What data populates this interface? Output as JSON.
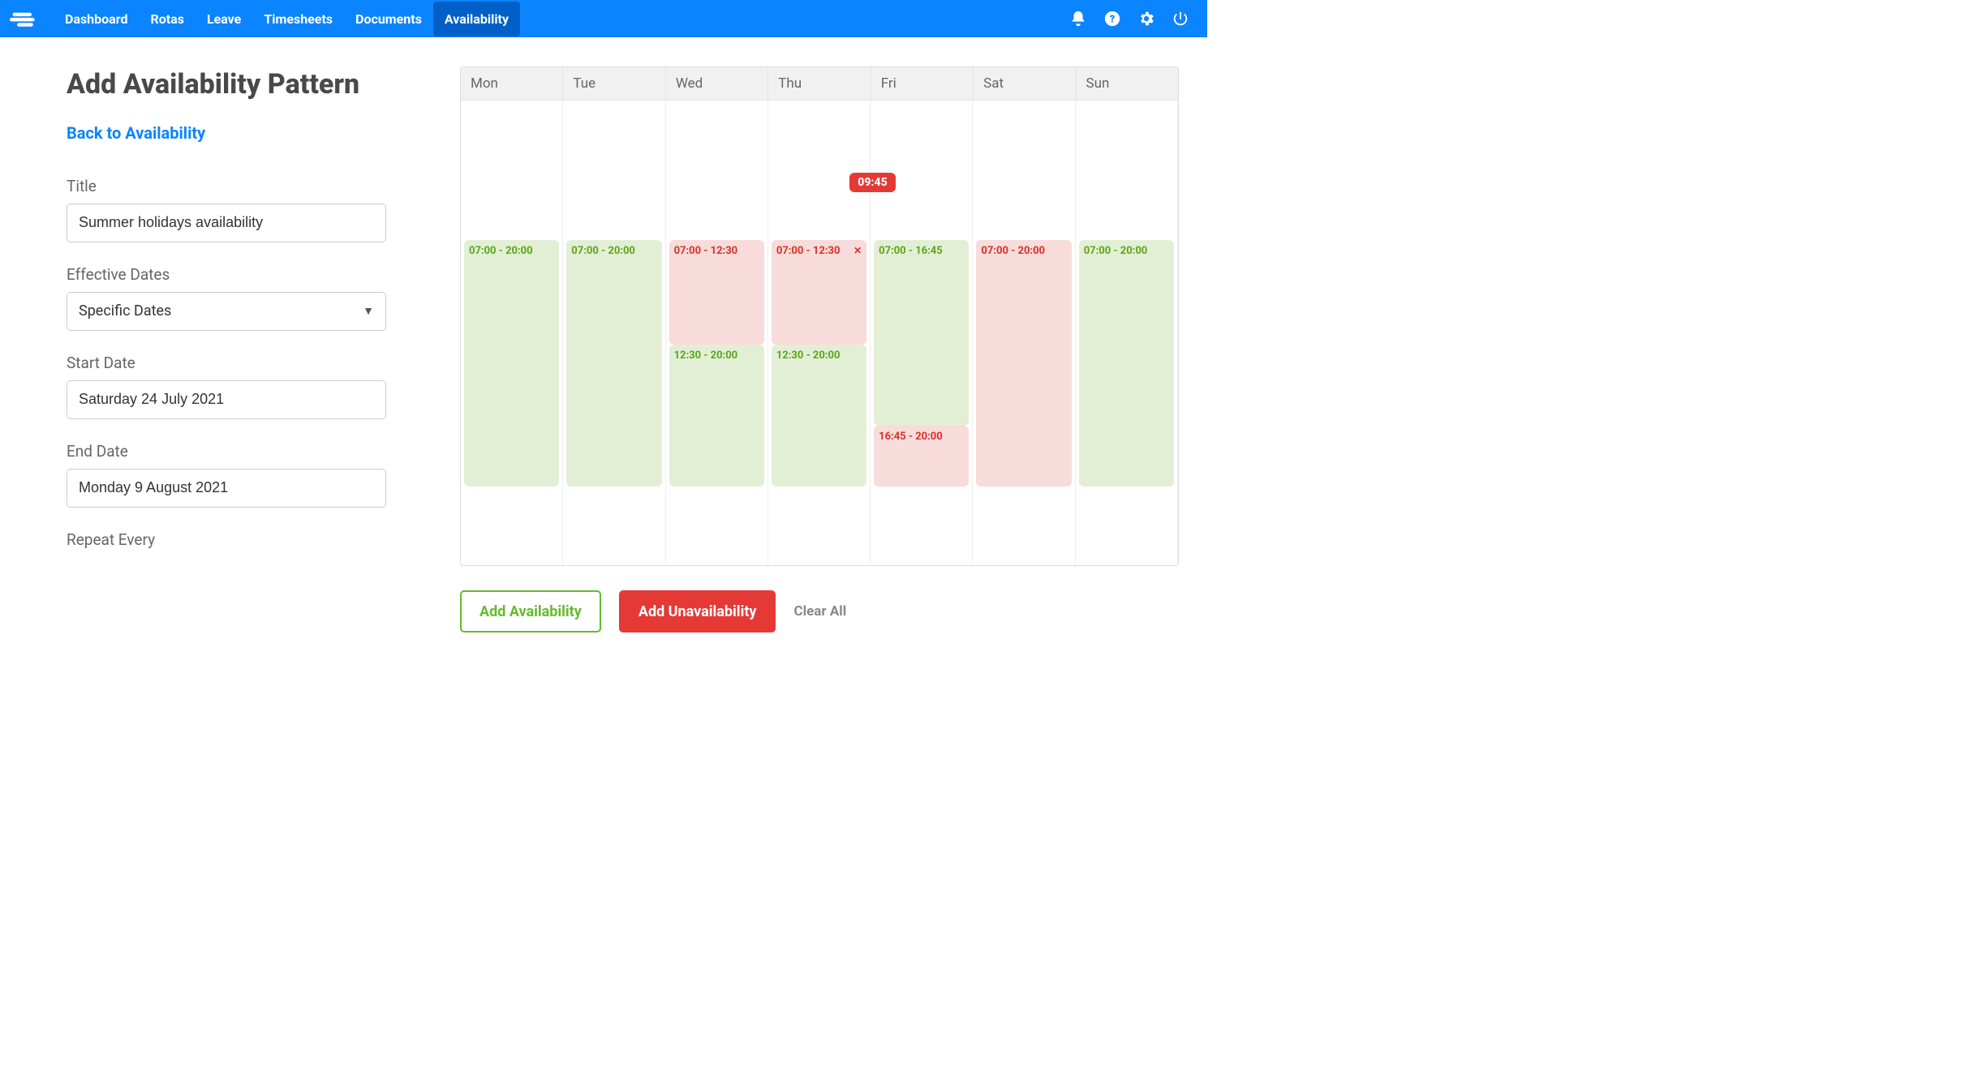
{
  "nav": {
    "links": [
      "Dashboard",
      "Rotas",
      "Leave",
      "Timesheets",
      "Documents",
      "Availability"
    ],
    "activeIndex": 5
  },
  "page": {
    "title": "Add Availability Pattern",
    "back": "Back to Availability"
  },
  "form": {
    "title_label": "Title",
    "title_value": "Summer holidays availability",
    "effective_label": "Effective Dates",
    "effective_value": "Specific Dates",
    "start_label": "Start Date",
    "start_value": "Saturday 24 July 2021",
    "end_label": "End Date",
    "end_value": "Monday 9 August 2021",
    "repeat_label": "Repeat Every"
  },
  "calendar": {
    "days": [
      "Mon",
      "Tue",
      "Wed",
      "Thu",
      "Fri",
      "Sat",
      "Sun"
    ],
    "badge": "09:45",
    "columns": [
      {
        "blocks": [
          {
            "type": "avail",
            "label": "07:00 - 20:00",
            "topPct": 30,
            "heightPct": 53,
            "closeX": false
          }
        ]
      },
      {
        "blocks": [
          {
            "type": "avail",
            "label": "07:00 - 20:00",
            "topPct": 30,
            "heightPct": 53,
            "closeX": false
          }
        ]
      },
      {
        "blocks": [
          {
            "type": "unavail",
            "label": "07:00 - 12:30",
            "topPct": 30,
            "heightPct": 22.5,
            "closeX": false
          },
          {
            "type": "avail",
            "label": "12:30 - 20:00",
            "topPct": 52.5,
            "heightPct": 30.5,
            "closeX": false
          }
        ]
      },
      {
        "blocks": [
          {
            "type": "unavail",
            "label": "07:00 - 12:30",
            "topPct": 30,
            "heightPct": 22.5,
            "closeX": true
          },
          {
            "type": "avail",
            "label": "12:30 - 20:00",
            "topPct": 52.5,
            "heightPct": 30.5,
            "closeX": false
          }
        ]
      },
      {
        "blocks": [
          {
            "type": "avail",
            "label": "07:00 - 16:45",
            "topPct": 30,
            "heightPct": 40,
            "closeX": false
          },
          {
            "type": "unavail",
            "label": "16:45 - 20:00",
            "topPct": 70,
            "heightPct": 13,
            "closeX": false
          }
        ]
      },
      {
        "blocks": [
          {
            "type": "unavail",
            "label": "07:00 - 20:00",
            "topPct": 30,
            "heightPct": 53,
            "closeX": false
          }
        ]
      },
      {
        "blocks": [
          {
            "type": "avail",
            "label": "07:00 - 20:00",
            "topPct": 30,
            "heightPct": 53,
            "closeX": false
          }
        ]
      }
    ]
  },
  "actions": {
    "add_avail": "Add Availability",
    "add_unavail": "Add Unavailability",
    "clear": "Clear All"
  }
}
